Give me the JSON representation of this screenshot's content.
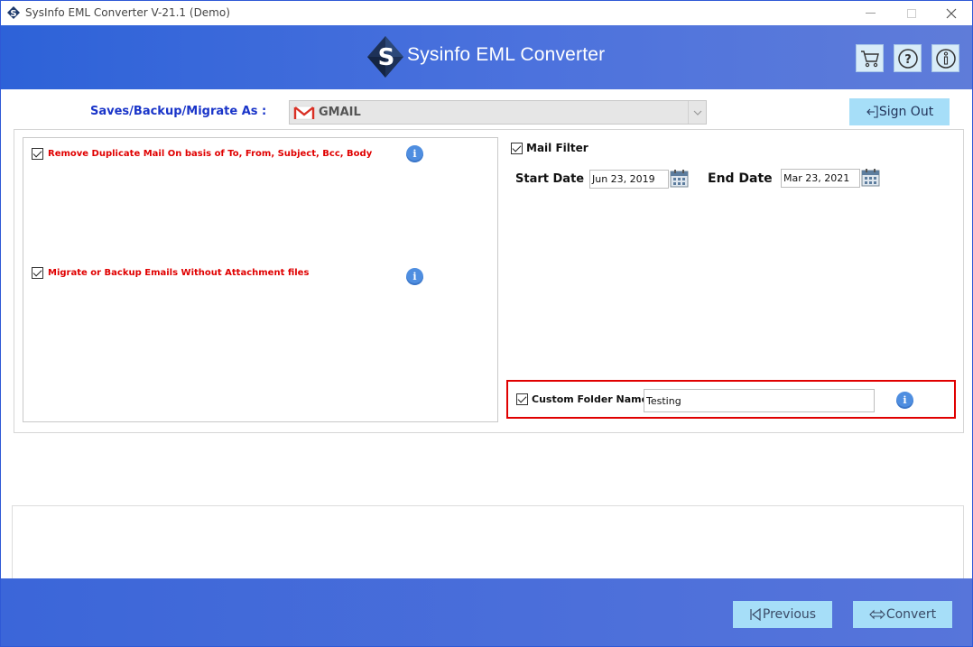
{
  "window": {
    "title": "SysInfo EML Converter V-21.1 (Demo)"
  },
  "header": {
    "title": "Sysinfo EML Converter",
    "logo_letter": "S",
    "icons": [
      "cart-icon",
      "help-icon",
      "info-icon"
    ]
  },
  "save_as": {
    "label": "Saves/Backup/Migrate As :",
    "selected": "GMAIL",
    "signout_label": "Sign Out"
  },
  "options": {
    "remove_duplicate": {
      "label": "Remove Duplicate Mail On basis of To, From, Subject, Bcc, Body",
      "checked": true
    },
    "without_attachment": {
      "label": "Migrate or Backup Emails Without Attachment files",
      "checked": true
    },
    "info_glyph": "i"
  },
  "mail_filter": {
    "label": "Mail Filter",
    "checked": true,
    "start_label": "Start Date",
    "start_value": "Jun 23, 2019",
    "end_label": "End Date",
    "end_value": "Mar 23, 2021"
  },
  "custom_folder": {
    "label": "Custom Folder Name",
    "checked": true,
    "value": "Testing"
  },
  "footer": {
    "previous_label": "Previous",
    "convert_label": "Convert"
  },
  "colors": {
    "header_blue": "#2d62d8",
    "button_bg": "#a6def8",
    "label_blue": "#1a35c9",
    "option_red": "#e00000",
    "highlight_red": "#e00000"
  }
}
